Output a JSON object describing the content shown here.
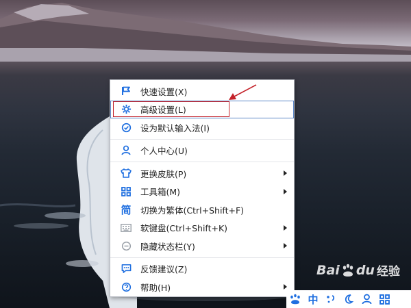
{
  "menu": {
    "items": [
      {
        "label": "快速设置(X)",
        "icon": "flag-icon",
        "color": "#1f6fe0",
        "submenu": false
      },
      {
        "label": "高级设置(L)",
        "icon": "gear-icon",
        "color": "#1f6fe0",
        "submenu": false,
        "highlighted": true
      },
      {
        "label": "设为默认输入法(I)",
        "icon": "check-circle-icon",
        "color": "#1f6fe0",
        "submenu": false
      },
      {
        "label": "个人中心(U)",
        "icon": "user-icon",
        "color": "#1f6fe0",
        "submenu": false
      },
      {
        "label": "更换皮肤(P)",
        "icon": "shirt-icon",
        "color": "#1f6fe0",
        "submenu": true
      },
      {
        "label": "工具箱(M)",
        "icon": "grid-icon",
        "color": "#1f6fe0",
        "submenu": true
      },
      {
        "label": "切换为繁体(Ctrl+Shift+F)",
        "icon": "traditional-char-icon",
        "glyph": "简",
        "color": "#1f6fe0",
        "submenu": false
      },
      {
        "label": "软键盘(Ctrl+Shift+K)",
        "icon": "keyboard-icon",
        "color": "#9aa0a8",
        "submenu": true
      },
      {
        "label": "隐藏状态栏(Y)",
        "icon": "minus-circle-icon",
        "color": "#9aa0a8",
        "submenu": true
      },
      {
        "label": "反馈建议(Z)",
        "icon": "chat-icon",
        "color": "#1f6fe0",
        "submenu": false
      },
      {
        "label": "帮助(H)",
        "icon": "help-icon",
        "color": "#1f6fe0",
        "submenu": true
      }
    ]
  },
  "tray": {
    "icons": [
      "paw-icon",
      "chinese-mode-icon",
      "punctuation-icon",
      "moon-icon",
      "user-icon",
      "grid-icon"
    ],
    "chinese_mode_label": "中",
    "accent": "#1f6fe0"
  },
  "watermark": {
    "bai": "Bai",
    "du": "du",
    "jingyan": "经验"
  },
  "colors": {
    "highlight_border": "#5b86c7",
    "annotation_red": "#c4222a"
  }
}
